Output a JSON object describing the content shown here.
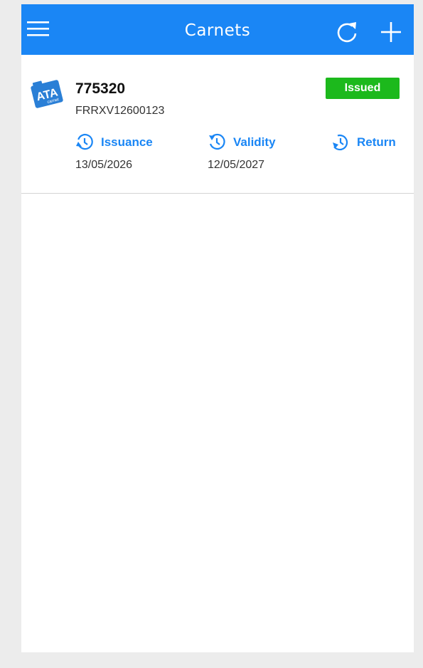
{
  "appbar": {
    "title": "Carnets",
    "icons": [
      "menu-icon",
      "refresh-icon",
      "add-icon"
    ],
    "color": "#1a86f5"
  },
  "carnets": [
    {
      "number": "775320",
      "reference": "FRRXV12600123",
      "status": "Issued",
      "status_color": "#1cb91c",
      "logo_icon": "ata-carnet-logo",
      "dates": {
        "issuance": {
          "label": "Issuance",
          "value": "13/05/2026"
        },
        "validity": {
          "label": "Validity",
          "value": "12/05/2027"
        },
        "return": {
          "label": "Return",
          "value": ""
        }
      }
    }
  ]
}
